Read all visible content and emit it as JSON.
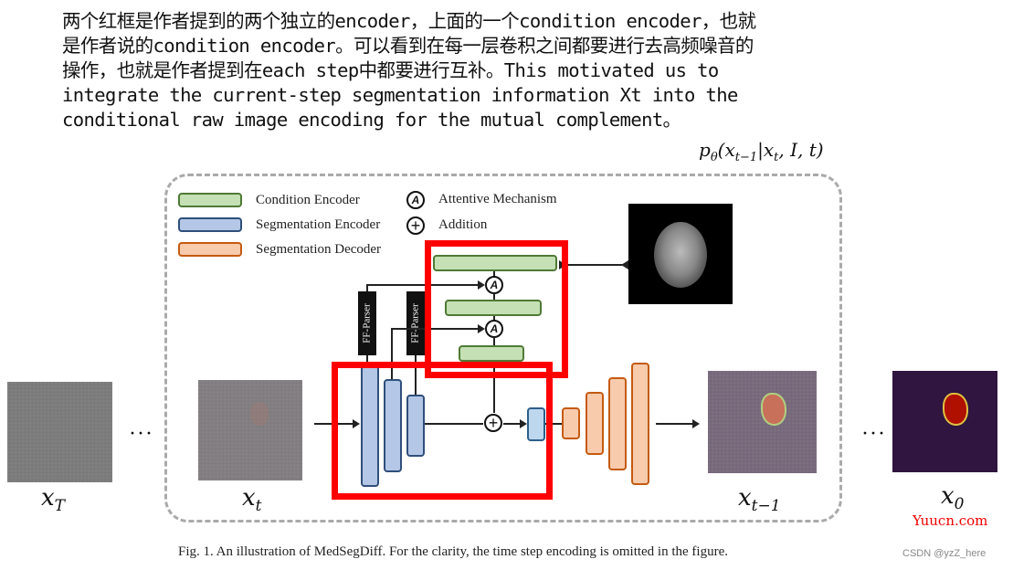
{
  "annotation": {
    "lines": [
      "两个红框是作者提到的两个独立的encoder，上面的一个condition encoder，也就",
      "是作者说的condition encoder。可以看到在每一层卷积之间都要进行去高频噪音的",
      "操作，也就是作者提到在each step中都要进行互补。This motivated us to",
      "integrate the current-step segmentation information Xt into the",
      "conditional raw image encoding for the mutual complement。"
    ]
  },
  "figure": {
    "formula": {
      "base": "p",
      "theta": "θ",
      "open": "(x",
      "sub1": "t−1",
      "mid": "|x",
      "sub2": "t",
      "rest": ", I, t)"
    },
    "legend": {
      "items": [
        {
          "label": "Condition Encoder",
          "color": "#c5e0b4",
          "border": "#4f7a36"
        },
        {
          "label": "Segmentation Encoder",
          "color": "#b4c7e7",
          "border": "#2f4f7a"
        },
        {
          "label": "Segmentation Decoder",
          "color": "#f8cbad",
          "border": "#c55a11"
        }
      ],
      "symbols": [
        {
          "glyph": "A",
          "label": "Attentive Mechanism"
        },
        {
          "glyph": "+",
          "label": "Addition"
        }
      ]
    },
    "ff_parser_label": "FF-Parser",
    "attention_glyph": "A",
    "addition_glyph": "+",
    "labels": {
      "xT": {
        "base": "x",
        "sub": "T"
      },
      "xt": {
        "base": "x",
        "sub": "t"
      },
      "xt1": {
        "base": "x",
        "sub": "t−1"
      },
      "x0": {
        "base": "x",
        "sub": "0"
      }
    },
    "ellipsis": "···",
    "caption": "Fig. 1.  An illustration of MedSegDiff. For the clarity, the time step encoding is omitted in the figure."
  },
  "watermarks": {
    "site": "Yuucn.com",
    "csdn": "CSDN @yzZ_here"
  }
}
